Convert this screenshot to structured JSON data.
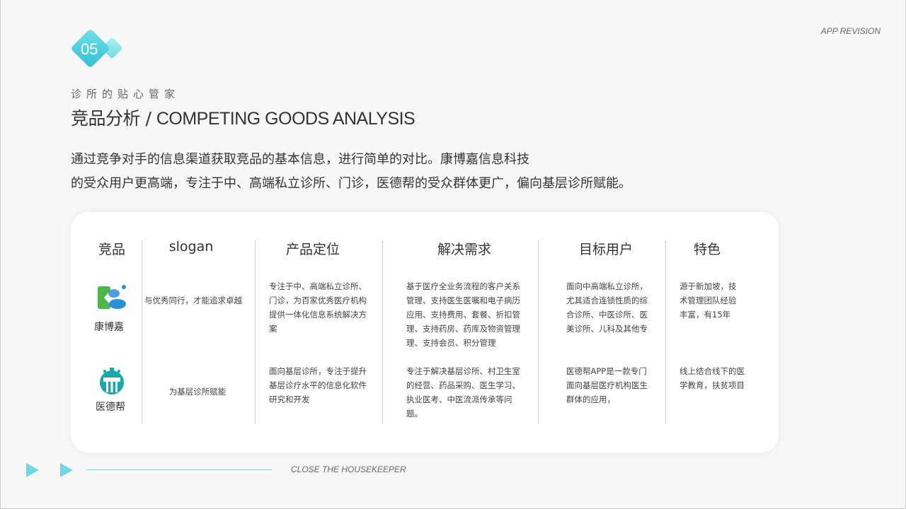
{
  "header": {
    "section_number": "05",
    "subtitle": "诊所的贴心管家",
    "title_cn": "竞品分析",
    "title_sep": " / ",
    "title_en": "COMPETING GOODS ANALYSIS",
    "corner_label": "APP REVISION"
  },
  "intro": {
    "line1": "通过竞争对手的信息渠道获取竞品的基本信息，进行简单的对比。康博嘉信息科技",
    "line2": "的受众用户更高端，专注于中、高端私立诊所、门诊，医德帮的受众群体更广，偏向基层诊所赋能。"
  },
  "table": {
    "headers": [
      "竞品",
      "slogan",
      "产品定位",
      "解决需求",
      "目标用户",
      "特色"
    ],
    "rows": [
      {
        "name": "康博嘉",
        "logo": "kangbojia-logo",
        "slogan": "与优秀同行，才能追求卓越",
        "positioning": [
          "专注于中、高端私立诊所、",
          "门诊，为百家优秀医疗机构",
          "提供一体化信息系统解决方",
          "案"
        ],
        "needs": [
          "基于医疗全业务流程的客户关系",
          "管理、支持医生医嘱和电子病历",
          "应用、支持费用、套餐、折扣管",
          "理、支持药房、药库及物资管理",
          "理、支持会员、积分管理"
        ],
        "users": [
          "面向中高端私立诊所，",
          "尤其适合连锁性质的综",
          "合诊所、中医诊所、医",
          "美诊所、儿科及其他专"
        ],
        "features": [
          "源于新加坡，技",
          "术管理团队经验",
          "丰富，有15年"
        ]
      },
      {
        "name": "医德帮",
        "logo": "yidebang-logo",
        "slogan": "为基层诊所赋能",
        "positioning": [
          "面向基层诊所，专注于提升",
          "基层诊疗水平的信息化软件",
          "研究和开发"
        ],
        "needs": [
          "专注于解决基层诊所、村卫生室",
          "的经营、药品采购、医生学习、",
          "执业医考、中医流派传承等问",
          "题。"
        ],
        "users": [
          "医德帮APP是一款专门",
          "面向基层医疗机构医生",
          "群体的应用，"
        ],
        "features": [
          "线上结合线下的医",
          "学教育，扶贫项目"
        ]
      }
    ]
  },
  "footer": {
    "label": "CLOSE THE HOUSEKEEPER"
  },
  "colors": {
    "accent_teal": "#3fc9d3",
    "accent_blue": "#7ee0ec",
    "kangbojia_green": "#4cb648",
    "kangbojia_blue": "#2a8fd6",
    "yidebang_teal": "#1aa8a8"
  }
}
